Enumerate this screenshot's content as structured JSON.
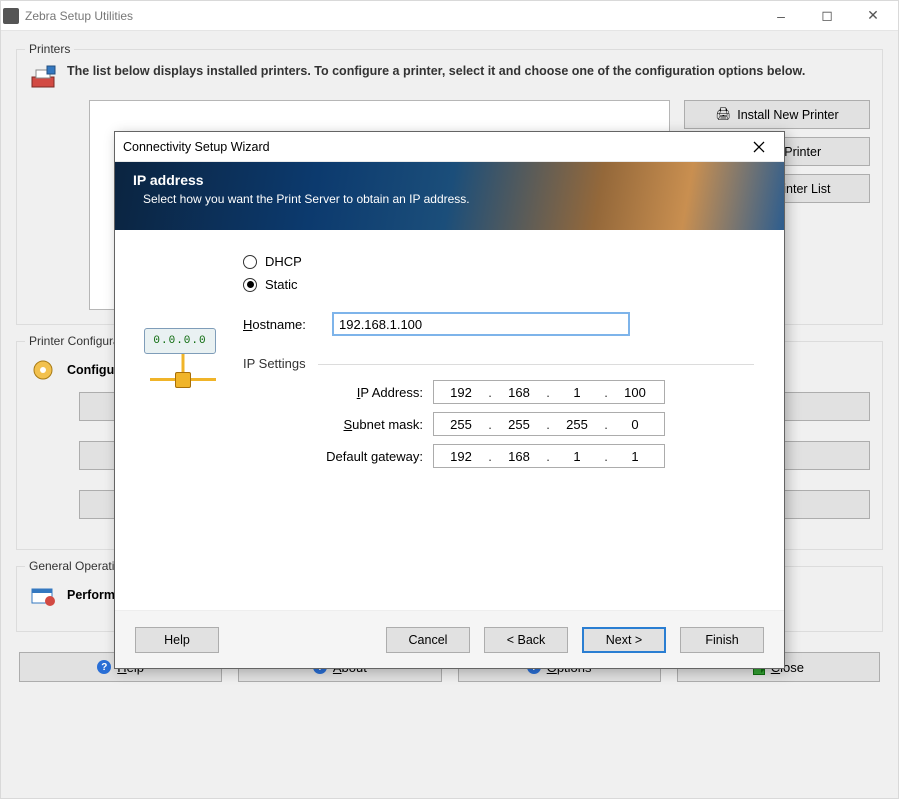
{
  "main": {
    "title": "Zebra Setup Utilities",
    "printers_group": "Printers",
    "description": "The list below displays installed printers. To configure a printer, select it and choose one of the configuration options below.",
    "install_new": "Install New Printer",
    "uninstall": "Uninstall Printer",
    "refresh_list": "Refresh Printer List",
    "config_group": "Printer Configuration",
    "config_label": "Configure the selected printer",
    "general_group": "General Operations",
    "general_label": "Perform the following application operations",
    "footer": {
      "help": "Help",
      "about": "About",
      "options": "Options",
      "close": "Close"
    }
  },
  "dialog": {
    "title": "Connectivity Setup Wizard",
    "banner_title": "IP address",
    "banner_sub": "Select how you want the Print Server to obtain an IP address.",
    "dhcp": "DHCP",
    "static": "Static",
    "hostname_label": "Hostname:",
    "hostname_value": "192.168.1.100",
    "ip_settings": "IP Settings",
    "ip_address_label": "IP Address:",
    "subnet_label": "Subnet mask:",
    "gateway_label": "Default gateway:",
    "ip_address": [
      "192",
      "168",
      "1",
      "100"
    ],
    "subnet": [
      "255",
      "255",
      "255",
      "0"
    ],
    "gateway": [
      "192",
      "168",
      "1",
      "1"
    ],
    "net_icon_text": "0.0.0.0",
    "buttons": {
      "help": "Help",
      "cancel": "Cancel",
      "back": "< Back",
      "next": "Next >",
      "finish": "Finish"
    }
  }
}
